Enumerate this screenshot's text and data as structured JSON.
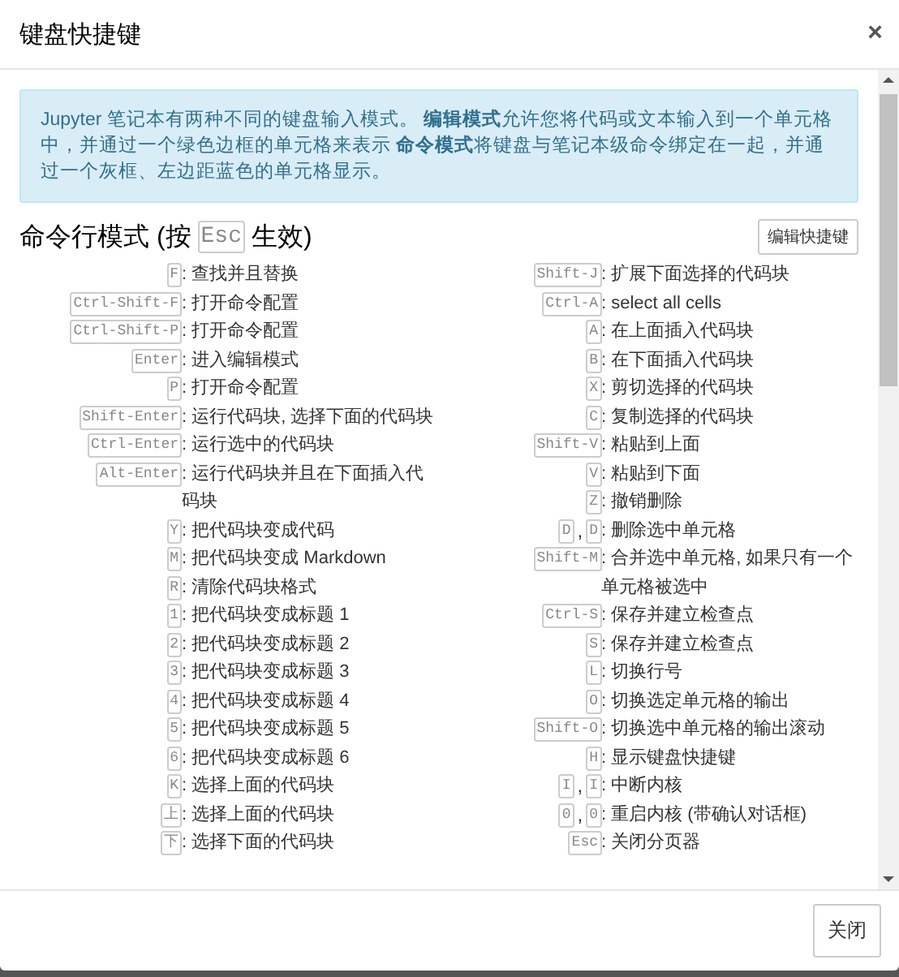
{
  "dialog": {
    "title": "键盘快捷键",
    "close_icon": "×"
  },
  "info": "Jupyter 笔记本有两种不同的键盘输入模式。 **编辑模式**允许您将代码或文本输入到一个单元格中，并通过一个绿色边框的单元格来表示 **命令模式**将键盘与笔记本级命令绑定在一起，并通过一个灰框、左边距蓝色的单元格显示。",
  "section": {
    "title_before": "命令行模式 (按",
    "title_key": "Esc",
    "title_after": "生效)",
    "edit_button": "编辑快捷键"
  },
  "key_joiner": ",",
  "columns": [
    [
      {
        "keys": [
          "F"
        ],
        "description": ": 查找并且替换"
      },
      {
        "keys": [
          "Ctrl-Shift-F"
        ],
        "description": ": 打开命令配置"
      },
      {
        "keys": [
          "Ctrl-Shift-P"
        ],
        "description": ": 打开命令配置"
      },
      {
        "keys": [
          "Enter"
        ],
        "description": ": 进入编辑模式"
      },
      {
        "keys": [
          "P"
        ],
        "description": ": 打开命令配置"
      },
      {
        "keys": [
          "Shift-Enter"
        ],
        "description": ": 运行代码块, 选择下面的代码块"
      },
      {
        "keys": [
          "Ctrl-Enter"
        ],
        "description": ": 运行选中的代码块"
      },
      {
        "keys": [
          "Alt-Enter"
        ],
        "description": ": 运行代码块并且在下面插入代码块"
      },
      {
        "keys": [
          "Y"
        ],
        "description": ": 把代码块变成代码"
      },
      {
        "keys": [
          "M"
        ],
        "description": ": 把代码块变成 Markdown"
      },
      {
        "keys": [
          "R"
        ],
        "description": ": 清除代码块格式"
      },
      {
        "keys": [
          "1"
        ],
        "description": ": 把代码块变成标题 1"
      },
      {
        "keys": [
          "2"
        ],
        "description": ": 把代码块变成标题 2"
      },
      {
        "keys": [
          "3"
        ],
        "description": ": 把代码块变成标题 3"
      },
      {
        "keys": [
          "4"
        ],
        "description": ": 把代码块变成标题 4"
      },
      {
        "keys": [
          "5"
        ],
        "description": ": 把代码块变成标题 5"
      },
      {
        "keys": [
          "6"
        ],
        "description": ": 把代码块变成标题 6"
      },
      {
        "keys": [
          "K"
        ],
        "description": ": 选择上面的代码块"
      },
      {
        "keys": [
          "上"
        ],
        "description": ": 选择上面的代码块"
      },
      {
        "keys": [
          "下"
        ],
        "description": ": 选择下面的代码块"
      }
    ],
    [
      {
        "keys": [
          "Shift-J"
        ],
        "description": ": 扩展下面选择的代码块"
      },
      {
        "keys": [
          "Ctrl-A"
        ],
        "description": ": select all cells"
      },
      {
        "keys": [
          "A"
        ],
        "description": ": 在上面插入代码块"
      },
      {
        "keys": [
          "B"
        ],
        "description": ": 在下面插入代码块"
      },
      {
        "keys": [
          "X"
        ],
        "description": ": 剪切选择的代码块"
      },
      {
        "keys": [
          "C"
        ],
        "description": ": 复制选择的代码块"
      },
      {
        "keys": [
          "Shift-V"
        ],
        "description": ": 粘贴到上面"
      },
      {
        "keys": [
          "V"
        ],
        "description": ": 粘贴到下面"
      },
      {
        "keys": [
          "Z"
        ],
        "description": ": 撤销删除"
      },
      {
        "keys": [
          "D",
          "D"
        ],
        "description": ": 删除选中单元格"
      },
      {
        "keys": [
          "Shift-M"
        ],
        "description": ": 合并选中单元格, 如果只有一个单元格被选中"
      },
      {
        "keys": [
          "Ctrl-S"
        ],
        "description": ": 保存并建立检查点"
      },
      {
        "keys": [
          "S"
        ],
        "description": ": 保存并建立检查点"
      },
      {
        "keys": [
          "L"
        ],
        "description": ": 切换行号"
      },
      {
        "keys": [
          "O"
        ],
        "description": ": 切换选定单元格的输出"
      },
      {
        "keys": [
          "Shift-O"
        ],
        "description": ": 切换选中单元格的输出滚动"
      },
      {
        "keys": [
          "H"
        ],
        "description": ": 显示键盘快捷键"
      },
      {
        "keys": [
          "I",
          "I"
        ],
        "description": ": 中断内核"
      },
      {
        "keys": [
          "0",
          "0"
        ],
        "description": ": 重启内核 (带确认对话框)"
      },
      {
        "keys": [
          "Esc"
        ],
        "description": ": 关闭分页器"
      }
    ]
  ],
  "footer": {
    "close_button": "关闭"
  }
}
